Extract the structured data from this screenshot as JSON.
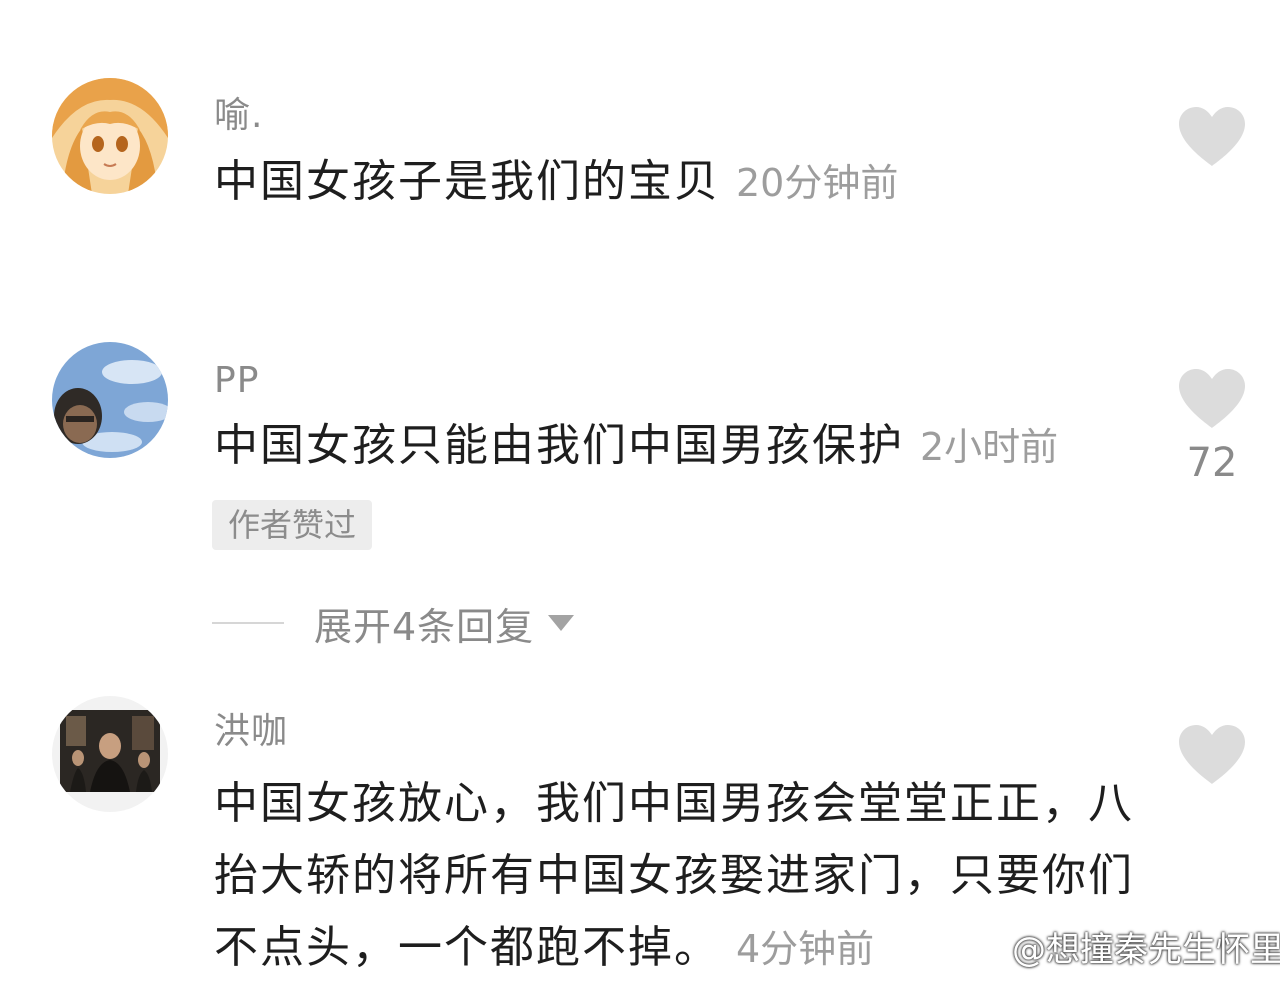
{
  "comments": [
    {
      "username": "喻.",
      "text": "中国女孩子是我们的宝贝",
      "time": "20分钟前",
      "like_count": ""
    },
    {
      "username": "PP",
      "text": "中国女孩只能由我们中国男孩保护",
      "time": "2小时前",
      "like_count": "72",
      "badge": "作者赞过",
      "expand_label": "展开4条回复"
    },
    {
      "username": "洪咖",
      "text": "中国女孩放心，我们中国男孩会堂堂正正，八抬大轿的将所有中国女孩娶进家门，只要你们不点头，一个都跑不掉。",
      "time": "4分钟前",
      "like_count": ""
    }
  ],
  "watermark": {
    "text": "@想撞秦先生怀里",
    "icon": "weibo-icon"
  },
  "colors": {
    "text": "#1e1e1e",
    "meta": "#8a8a8a",
    "heart": "#dcdcdc",
    "badge_bg": "#ededed"
  }
}
